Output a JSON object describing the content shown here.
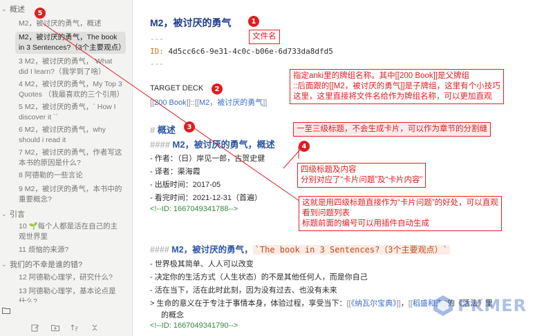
{
  "sidebar": {
    "sections": [
      {
        "label": "概述"
      },
      {
        "label": "引言"
      },
      {
        "label": "我们的不幸是谁的错?"
      }
    ],
    "items": [
      {
        "label": "M2，被讨厌的勇气，概述"
      },
      {
        "label": "M2，被讨厌的勇气，The book in 3 Sentences?（3个主要观点）"
      },
      {
        "label": "3 M2，被讨厌的勇气，`What did I learn?（我学到了啥）"
      },
      {
        "label": "4 M2，被讨厌的勇气，My Top 3 Quotes （我最喜欢的三个引用）"
      },
      {
        "label": "5 M2，被讨厌的勇气，` How I discover it ``"
      },
      {
        "label": "6 M2，被讨厌的勇气，why should i read it"
      },
      {
        "label": "7 M2，被讨厌的勇气，作者写这本书的原因是什么?"
      },
      {
        "label": "8 阿德勒的一些言论"
      },
      {
        "label": "9 M2，被讨厌的勇气，本书中的重要概念?"
      },
      {
        "label": "10 🌱每个人都是活在自己的主观世界里"
      },
      {
        "label": "11 烦恼的来源?"
      },
      {
        "label": "12 阿德勒心理学，研究什么?"
      },
      {
        "label": "13 阿德勒心理学，基本论点是什么?"
      }
    ]
  },
  "editor": {
    "title": "M2，被讨厌的勇气",
    "dashes": "---",
    "id_key": "ID:",
    "id_value": "4d5cc6c6-9e31-4c0c-b06e-6d733da8dfd5",
    "deck_label": "TARGET DECK",
    "deck_open1": "[[",
    "deck_parent": "200 Book",
    "deck_sep": "]]::[[",
    "deck_child": "M2，被讨厌的勇气",
    "deck_close": "]]",
    "h1_hash": "#",
    "h1_text": "概述",
    "h4_hash": "####",
    "h4_text": "M2，被讨厌的勇气，概述",
    "meta": [
      {
        "text": "- 作者：（日）岸见一郎，古贺史健"
      },
      {
        "text": "- 译者：渠海霞"
      },
      {
        "text": "- 出版时间：2017-05"
      },
      {
        "text": "- 看完时间：2021-12-31（首遍）"
      }
    ],
    "id_comment_1": "<!--ID: 1667049341788-->",
    "h4b_text": "M2，被讨厌的勇气，",
    "h4b_code": "`The book in 3 Sentences?（3个主要观点）`",
    "bullets": [
      {
        "text": "- 世界极其简单、人人可以改变"
      },
      {
        "text": "- 决定你的生活方式（人生状态）的不是其他任何人，而是你自己"
      },
      {
        "text": "- 活在当下，活在此时此刻，因为没有过去、也没有未来"
      }
    ],
    "quote_pre": "> 生命的意义在于专注于事情本身，体验过程，享受当下：",
    "quote_b1": "[[",
    "quote_link1": "《纳瓦尔宝典》",
    "quote_b2": "]]",
    "quote_mid": "，",
    "quote_b3": "[[",
    "quote_link2": "稻盛和夫",
    "quote_b4": "]]",
    "quote_post": "的《活法》里",
    "quote_cont": "的概念",
    "id_comment_2": "<!--ID: 1667049341790-->"
  },
  "annotations": {
    "badges": [
      "1",
      "2",
      "3",
      "4",
      "5"
    ],
    "note1": "文件名",
    "note2": [
      "指定anki里的牌组名称。其中[[200 Book]]是父牌组",
      "::后面跟的[[M2，被讨厌的勇气]]是子牌组，这里有个小技巧",
      "这里，这里直接将文件名给作为牌组名称，可以更加直观"
    ],
    "note3": "一至三级标题，不会生成卡片，可以作为章节的分割缝",
    "note4": [
      "四级标题及内容",
      "分别对应了“卡片问题”及“卡片内容”"
    ],
    "note5": [
      "这就是用四级标题直接作为“卡片问题”的好处，可以直观",
      "看到问题列表",
      "标题前面的编号可以用插件自动生成"
    ],
    "color": "#e11d20"
  },
  "watermark": "PKMER"
}
